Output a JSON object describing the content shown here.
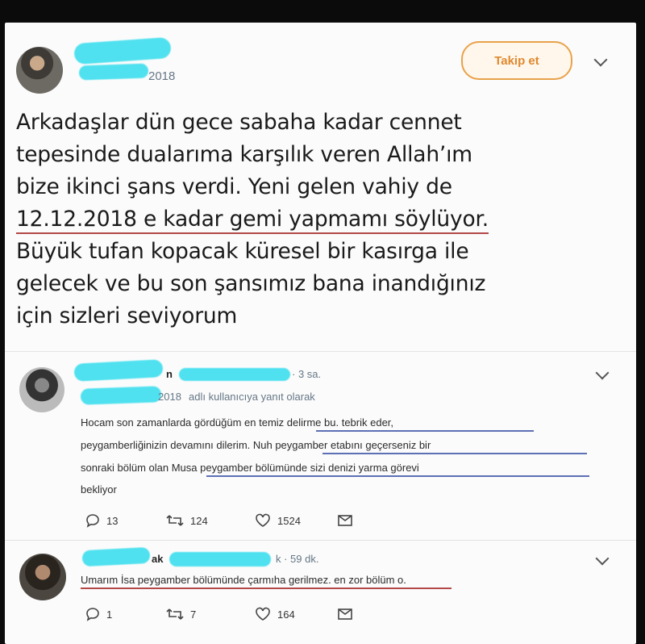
{
  "main": {
    "handle_suffix": "2018",
    "follow_label": "Takip et",
    "tweet_lines": [
      "Arkadaşlar dün gece sabaha kadar cennet",
      "tepesinde dualarıma karşılık veren Allah’ım",
      "bize ikinci şans verdi. Yeni gelen vahiy de",
      "12.12.2018 e kadar gemi yapmamı söylüyor.",
      "Büyük tufan kopacak küresel bir kasırga ile",
      "gelecek ve bu son şansımız bana inandığınız",
      "için sizleri seviyorum"
    ]
  },
  "reply1": {
    "name_fragment": "n",
    "time": "· 3 sa.",
    "replying_suffix": "2018",
    "replying_label": "adlı kullanıcıya yanıt olarak",
    "lines": [
      "Hocam son zamanlarda gördüğüm en temiz delirme bu. tebrik eder,",
      "peygamberliğinizin devamını dilerim. Nuh peygamber etabını geçerseniz bir",
      "sonraki bölüm olan Musa peygamber bölümünde sizi denizi yarma görevi",
      "bekliyor"
    ],
    "counts": {
      "reply": "13",
      "retweet": "124",
      "like": "1524"
    }
  },
  "reply2": {
    "name_fragment": "ak",
    "time": "k · 59 dk.",
    "text": "Umarım İsa peygamber bölümünde çarmıha gerilmez. en zor bölüm o.",
    "counts": {
      "reply": "1",
      "retweet": "7",
      "like": "164"
    }
  },
  "colors": {
    "follow_border": "#e8a24a",
    "redaction": "#4fe1ef",
    "underline_red": "#b44848",
    "underline_blue": "#5d6fb5"
  },
  "icons": [
    "reply-icon",
    "retweet-icon",
    "like-icon",
    "message-icon",
    "chevron-down-icon"
  ]
}
